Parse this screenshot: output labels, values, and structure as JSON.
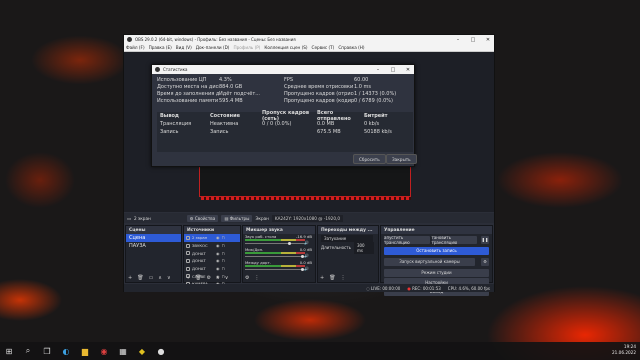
{
  "window": {
    "title": "OBS 29.0.2 (64-bit, windows) - Профиль: Без названия - Сцены: Без названия",
    "menu": [
      "Файл (F)",
      "Правка (E)",
      "Вид (V)",
      "Док-панели (D)",
      "Профиль (P)",
      "Коллекция сцен (S)",
      "Сервис (T)",
      "Справка (H)"
    ]
  },
  "stats": {
    "title": "Статистика",
    "left": [
      {
        "k": "Использование ЦП",
        "v": "4.3%"
      },
      {
        "k": "Доступно места на диске",
        "v": "884.0 GB"
      },
      {
        "k": "Время до заполнения диска",
        "v": "Идёт подсчёт..."
      },
      {
        "k": "Использование памяти",
        "v": "595.4 MB"
      }
    ],
    "right": [
      {
        "k": "FPS",
        "v": "60.00"
      },
      {
        "k": "Среднее время отрисовки кадра",
        "v": "1.0 ms"
      },
      {
        "k": "Пропущено кадров (отрисовка)",
        "v": "1 / 14373 (0.0%)"
      },
      {
        "k": "Пропущено кадров (кодирование)",
        "v": "0 / 6789 (0.0%)"
      }
    ],
    "table_head": [
      "Вывод",
      "Состояние",
      "Пропуск кадров (сеть)",
      "Всего отправлено",
      "Битрейт"
    ],
    "table_rows": [
      [
        "Трансляция",
        "Неактивна",
        "0 / 0 (0.0%)",
        "0.0 MB",
        "0 kb/s"
      ],
      [
        "Запись",
        "Запись",
        "",
        "675.5 MB",
        "50188 kb/s"
      ]
    ],
    "reset": "Сбросить",
    "close": "Закрыть"
  },
  "srcbar": {
    "name": "2 экран",
    "props": "Свойства",
    "filters": "Фильтры",
    "screen_label": "Экран",
    "screen_value": "KA242Y: 1920x1080 @ -1920,0"
  },
  "scenes": {
    "title": "Сцены",
    "items": [
      "Сцена",
      "ПАУЗА"
    ]
  },
  "sources": {
    "title": "Источники",
    "items": [
      "2 экран",
      "ЗВУКОС",
      "ДОНАТ",
      "ДОНАТ",
      "ДОНАТ",
      "СЛОВЕ",
      "КАМЕРА"
    ]
  },
  "mixer": {
    "title": "Микшер звука",
    "channels": [
      {
        "name": "Звук раб. стола",
        "db": "-16.9 dB",
        "level": 0.7
      },
      {
        "name": "Мик/Доп.",
        "db": "0.0 dB",
        "level": 0.9
      },
      {
        "name": "Между дорт.",
        "db": "0.0 dB",
        "level": 0.9
      }
    ]
  },
  "transitions": {
    "title": "Переходы между ...",
    "type": "Затухание",
    "duration_label": "Длительность",
    "duration": "300 ms"
  },
  "controls": {
    "title": "Управление",
    "start_stream": "апустить трансляцию",
    "stop_replay": "тановить трансляцию",
    "stop_recording": "Остановить запись",
    "virtual_cam": "Запуск виртуальной камеры",
    "studio": "Режим студии",
    "settings": "Настройки",
    "exit": "Выход"
  },
  "status": {
    "live": "LIVE: 00:00:00",
    "rec": "REC: 00:01:53",
    "cpu": "CPU: 4.6%, 60.00 fps"
  },
  "taskbar": {
    "time": "19:24",
    "date": "21.06.2022"
  },
  "colors": {
    "accent": "#2e5bd6",
    "lava": "#ff3300"
  }
}
